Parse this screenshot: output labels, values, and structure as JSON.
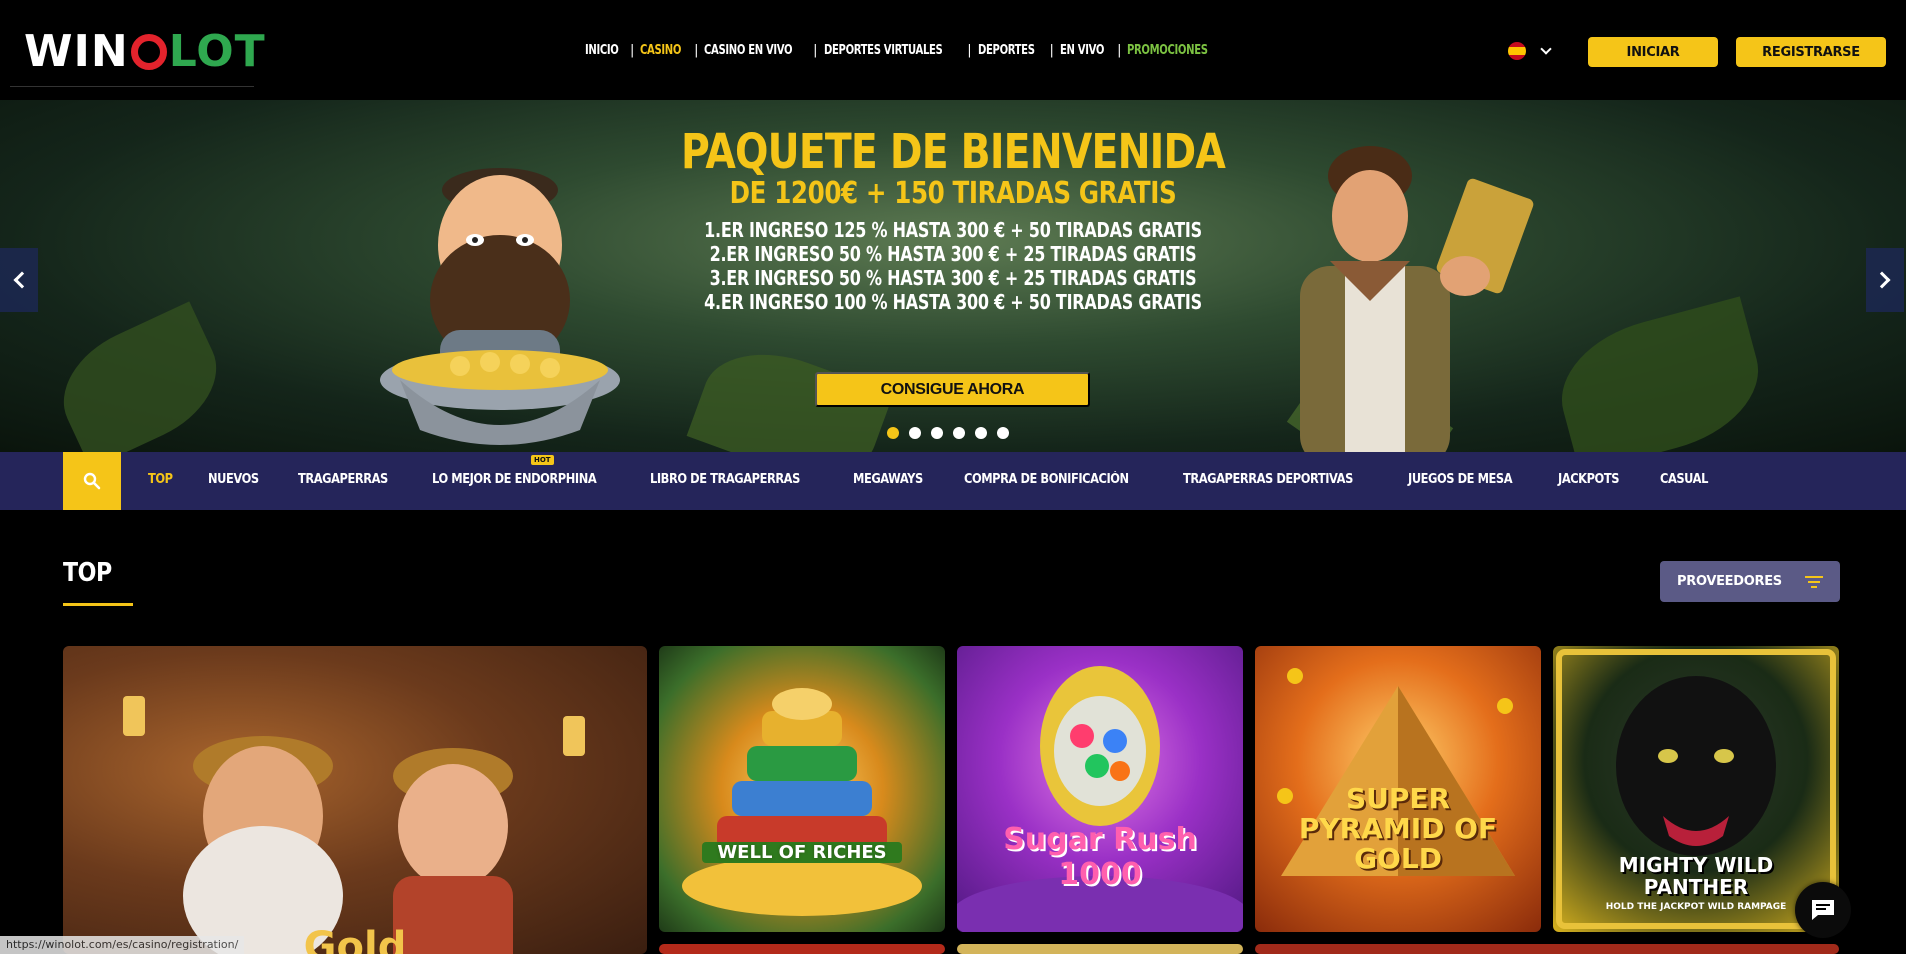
{
  "brand": {
    "logo_left": "WIN",
    "logo_right": "LOT"
  },
  "topnav": [
    {
      "label": "INICIO",
      "state": "normal"
    },
    {
      "label": "CASINO",
      "state": "active"
    },
    {
      "label": "CASINO EN VIVO",
      "state": "normal"
    },
    {
      "label": "DEPORTES VIRTUALES",
      "state": "normal"
    },
    {
      "label": "DEPORTES",
      "state": "normal"
    },
    {
      "label": "EN VIVO",
      "state": "normal"
    },
    {
      "label": "PROMOCIONES",
      "state": "promo"
    }
  ],
  "language": {
    "flag": "spain-flag-icon"
  },
  "auth": {
    "login_label": "INICIAR",
    "register_label": "REGISTRARSE"
  },
  "hero": {
    "title": "PAQUETE DE BIENVENIDA",
    "subtitle": "DE 1200€ + 150 TIRADAS GRATIS",
    "lines": [
      "1.ER INGRESO 125 % HASTA 300 € + 50 TIRADAS GRATIS",
      "2.ER INGRESO 50 % HASTA 300 € + 25 TIRADAS GRATIS",
      "3.ER INGRESO 50 % HASTA 300 € + 25 TIRADAS GRATIS",
      "4.ER INGRESO 100 %  HASTA 300 € + 50 TIRADAS GRATIS"
    ],
    "cta_label": "CONSIGUE AHORA",
    "slides_total": 6,
    "active_slide": 1
  },
  "categories": [
    "TOP",
    "NUEVOS",
    "TRAGAPERRAS",
    "LO MEJOR DE ENDORPHINA",
    "LIBRO DE TRAGAPERRAS",
    "MEGAWAYS",
    "COMPRA DE BONIFICACIÓN",
    "TRAGAPERRAS DEPORTIVAS",
    "JUEGOS DE MESA",
    "JACKPOTS",
    "CASUAL"
  ],
  "category_badge": "HOT",
  "section": {
    "title": "TOP",
    "providers_label": "PROVEEDORES"
  },
  "games": [
    {
      "name": "Gold"
    },
    {
      "name": "WELL OF RICHES"
    },
    {
      "name": "Sugar Rush 1000"
    },
    {
      "name": "SUPER PYRAMID OF GOLD"
    },
    {
      "name": "MIGHTY WILD PANTHER"
    }
  ],
  "games_sub": {
    "panther": "HOLD THE JACKPOT WILD RAMPAGE"
  },
  "status_url": "https://winolot.com/es/casino/registration/"
}
